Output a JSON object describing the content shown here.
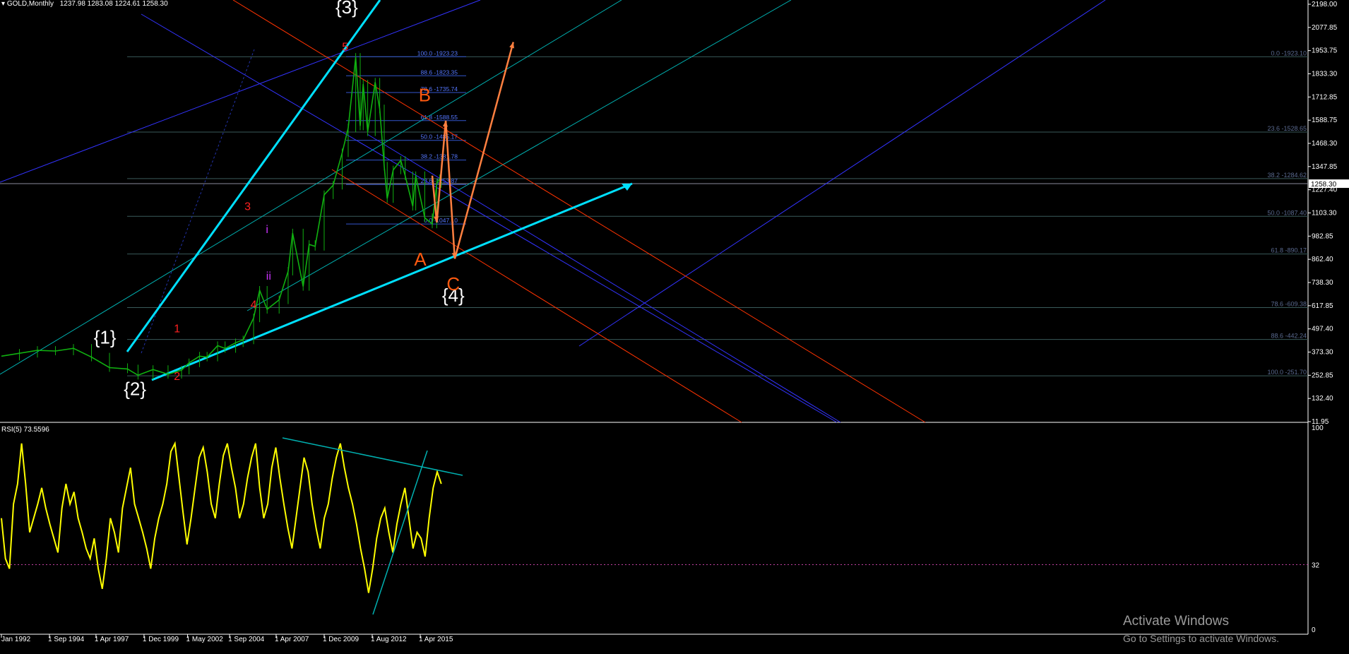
{
  "header": {
    "symbol": "GOLD,Monthly",
    "ohlc": "1237.98 1283.08 1224.61 1258.30"
  },
  "rsi_header": "RSI(5) 73.5596",
  "watermark": {
    "title": "Activate Windows",
    "subtitle": "Go to Settings to activate Windows."
  },
  "colors": {
    "background": "#000000",
    "price": "#10b010",
    "rsi": "#ffff00",
    "impulse": "#00e0ff",
    "channel": "#00b0b0",
    "blue_line": "#3333ff",
    "red_line": "#ff3300",
    "abc": "#ff8040",
    "fib": "#3a5a5a",
    "fib_text": "#5a6a90"
  },
  "chart_data": [
    {
      "type": "candlestick",
      "title": "GOLD,Monthly",
      "ohlc_last": {
        "open": 1237.98,
        "high": 1283.08,
        "low": 1224.61,
        "close": 1258.3
      },
      "current_price": "1258.30",
      "y_tick_labels": [
        "2198.00",
        "2077.85",
        "1953.75",
        "1833.30",
        "1712.85",
        "1588.75",
        "1468.30",
        "1347.85",
        "1227.40",
        "1103.30",
        "982.85",
        "862.40",
        "738.30",
        "617.85",
        "497.40",
        "373.30",
        "252.85",
        "132.40",
        "11.95"
      ],
      "x_tick_labels": [
        "Jan 1992",
        "1 Sep 1994",
        "1 Apr 1997",
        "1 Dec 1999",
        "1 May 2002",
        "1 Sep 2004",
        "1 Apr 2007",
        "1 Dec 2009",
        "1 Aug 2012",
        "1 Apr 2015"
      ],
      "ylim": [
        11.95,
        2198.0
      ],
      "series": [
        {
          "values": [
            [
              "1992-01",
              355
            ],
            [
              "1993-01",
              370
            ],
            [
              "1994-01",
              385
            ],
            [
              "1995-01",
              382
            ],
            [
              "1996-01",
              396
            ],
            [
              "1997-01",
              350
            ],
            [
              "1998-01",
              295
            ],
            [
              "1999-01",
              288
            ],
            [
              "1999-08",
              255
            ],
            [
              "2000-06",
              285
            ],
            [
              "2001-04",
              260
            ],
            [
              "2002-01",
              282
            ],
            [
              "2002-06",
              320
            ],
            [
              "2003-01",
              355
            ],
            [
              "2003-06",
              350
            ],
            [
              "2004-01",
              410
            ],
            [
              "2004-06",
              395
            ],
            [
              "2005-01",
              425
            ],
            [
              "2005-06",
              440
            ],
            [
              "2006-01",
              555
            ],
            [
              "2006-05",
              700
            ],
            [
              "2006-10",
              600
            ],
            [
              "2007-06",
              650
            ],
            [
              "2007-12",
              800
            ],
            [
              "2008-03",
              1000
            ],
            [
              "2008-10",
              720
            ],
            [
              "2009-02",
              940
            ],
            [
              "2009-06",
              930
            ],
            [
              "2009-12",
              1200
            ],
            [
              "2010-06",
              1250
            ],
            [
              "2010-12",
              1420
            ],
            [
              "2011-04",
              1550
            ],
            [
              "2011-09",
              1920
            ],
            [
              "2011-12",
              1560
            ],
            [
              "2012-02",
              1780
            ],
            [
              "2012-05",
              1530
            ],
            [
              "2012-10",
              1790
            ],
            [
              "2013-01",
              1650
            ],
            [
              "2013-04",
              1350
            ],
            [
              "2013-06",
              1180
            ],
            [
              "2013-10",
              1330
            ],
            [
              "2014-03",
              1380
            ],
            [
              "2014-06",
              1300
            ],
            [
              "2014-11",
              1140
            ],
            [
              "2015-01",
              1300
            ],
            [
              "2015-07",
              1080
            ],
            [
              "2015-12",
              1047
            ],
            [
              "2016-03",
              1260
            ],
            [
              "2016-05",
              1284
            ],
            [
              "2016-06",
              1258
            ]
          ]
        }
      ],
      "fib_left": [
        {
          "label": "100.0 -1923.23",
          "value": 1923.23
        },
        {
          "label": "88.6 -1823.35",
          "value": 1823.35
        },
        {
          "label": "78.6 -1735.74",
          "value": 1735.74
        },
        {
          "label": "61.8 -1588.55",
          "value": 1588.55
        },
        {
          "label": "50.0 -1485.17",
          "value": 1485.17
        },
        {
          "label": "38.2 -1381.78",
          "value": 1381.78
        },
        {
          "label": "23.6 -1253.87",
          "value": 1253.87
        },
        {
          "label": "0.0 -1047.10",
          "value": 1047.1
        }
      ],
      "fib_right": [
        {
          "label": "0.0 -1923.10",
          "value": 1923.1
        },
        {
          "label": "23.6 -1528.65",
          "value": 1528.65
        },
        {
          "label": "38.2 -1284.62",
          "value": 1284.62
        },
        {
          "label": "50.0 -1087.40",
          "value": 1087.4
        },
        {
          "label": "61.8 -890.17",
          "value": 890.17
        },
        {
          "label": "78.6 -609.38",
          "value": 609.38
        },
        {
          "label": "88.6 -442.24",
          "value": 442.24
        },
        {
          "label": "100.0 -251.70",
          "value": 251.7
        }
      ],
      "wave_labels": [
        {
          "text": "{1}",
          "kind": "major",
          "date": "1997-10",
          "price": 420
        },
        {
          "text": "{2}",
          "kind": "major",
          "date": "1999-06",
          "price": 150
        },
        {
          "text": "{3}",
          "kind": "major",
          "date": "2011-03",
          "price": 2150
        },
        {
          "text": "{4}",
          "kind": "major",
          "date": "2017-02",
          "price": 640
        },
        {
          "text": "1",
          "kind": "minor",
          "date": "2001-10",
          "price": 480
        },
        {
          "text": "2",
          "kind": "minor",
          "date": "2001-10",
          "price": 230
        },
        {
          "text": "3",
          "kind": "minor",
          "date": "2005-09",
          "price": 1120
        },
        {
          "text": "4",
          "kind": "minor",
          "date": "2006-01",
          "price": 605
        },
        {
          "text": "5",
          "kind": "minor",
          "date": "2011-02",
          "price": 1955
        },
        {
          "text": "i",
          "kind": "sub",
          "date": "2006-10",
          "price": 1000
        },
        {
          "text": "ii",
          "kind": "sub",
          "date": "2006-11",
          "price": 755
        },
        {
          "text": "A",
          "kind": "abc",
          "date": "2015-04",
          "price": 830
        },
        {
          "text": "B",
          "kind": "abc",
          "date": "2015-07",
          "price": 1690
        },
        {
          "text": "C",
          "kind": "abc",
          "date": "2017-02",
          "price": 700
        }
      ],
      "projection_path": [
        [
          "2015-12",
          1300
        ],
        [
          "2016-03",
          1055
        ],
        [
          "2016-09",
          1588
        ],
        [
          "2017-03",
          865
        ],
        [
          "2020-06",
          2000
        ]
      ]
    },
    {
      "type": "line",
      "title": "RSI(5) 73.5596",
      "ylim": [
        0,
        100
      ],
      "y_tick_labels": [
        "100",
        "32",
        "0"
      ],
      "levels": [
        32
      ],
      "series": [
        {
          "values": [
            55,
            35,
            30,
            62,
            72,
            92,
            72,
            48,
            55,
            62,
            70,
            60,
            52,
            45,
            38,
            60,
            72,
            62,
            68,
            55,
            48,
            40,
            35,
            45,
            30,
            20,
            35,
            55,
            48,
            38,
            60,
            70,
            80,
            62,
            55,
            48,
            40,
            30,
            45,
            55,
            62,
            72,
            88,
            92,
            75,
            58,
            42,
            55,
            70,
            85,
            90,
            78,
            62,
            55,
            72,
            86,
            92,
            80,
            70,
            55,
            62,
            75,
            85,
            92,
            70,
            55,
            62,
            80,
            90,
            75,
            62,
            50,
            40,
            55,
            70,
            85,
            78,
            62,
            50,
            40,
            55,
            62,
            75,
            85,
            92,
            80,
            70,
            62,
            52,
            40,
            30,
            18,
            30,
            45,
            55,
            60,
            48,
            38,
            52,
            62,
            70,
            55,
            40,
            48,
            45,
            36,
            55,
            70,
            78,
            72
          ]
        }
      ]
    }
  ]
}
